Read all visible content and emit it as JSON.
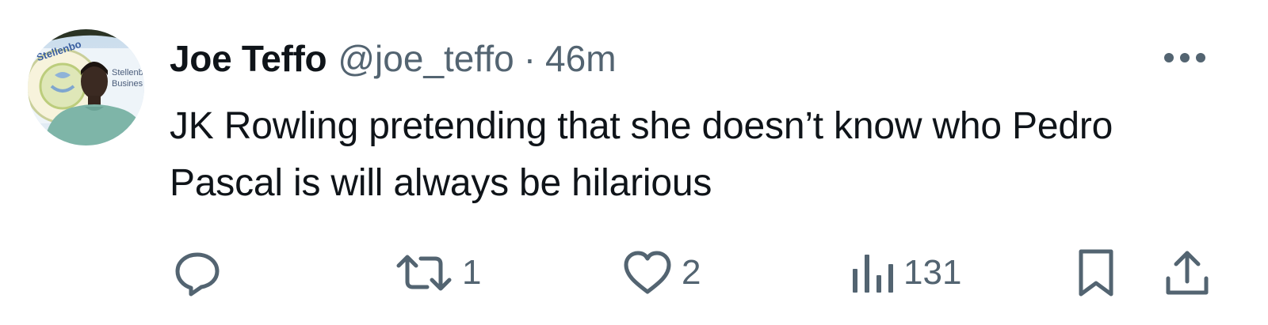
{
  "tweet": {
    "display_name": "Joe Teffo",
    "handle": "@joe_teffo",
    "separator": "·",
    "time": "46m",
    "text": "JK Rowling pretending that she doesn’t know who Pedro Pascal is will always be hilarious"
  },
  "avatar": {
    "sign_text_1": "Stellenbo",
    "sign_text_2": "Stellenb",
    "sign_text_3": "Busines"
  },
  "actions": {
    "reply_icon": "reply-icon",
    "retweet_icon": "retweet-icon",
    "retweet_count": "1",
    "like_icon": "heart-icon",
    "like_count": "2",
    "views_icon": "views-icon",
    "views_count": "131",
    "bookmark_icon": "bookmark-icon",
    "share_icon": "share-icon"
  },
  "colors": {
    "text_primary": "#0f1419",
    "text_secondary": "#536471",
    "background": "#ffffff"
  }
}
